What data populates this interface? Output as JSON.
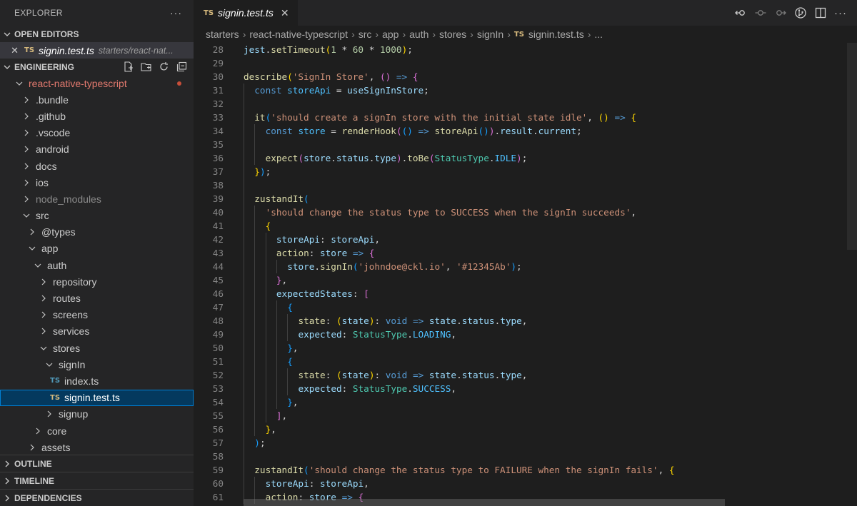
{
  "sidebar": {
    "title": "EXPLORER",
    "more": "···",
    "open_editors": {
      "label": "OPEN EDITORS",
      "items": [
        {
          "close": "✕",
          "badge": "TS",
          "name": "signin.test.ts",
          "path": "starters/react-nat..."
        }
      ]
    },
    "workspace": {
      "label": "ENGINEERING",
      "tree": [
        {
          "label": "react-native-typescript",
          "depth": 1,
          "type": "folder-open",
          "modified": true
        },
        {
          "label": ".bundle",
          "depth": 2,
          "type": "folder"
        },
        {
          "label": ".github",
          "depth": 2,
          "type": "folder"
        },
        {
          "label": ".vscode",
          "depth": 2,
          "type": "folder"
        },
        {
          "label": "android",
          "depth": 2,
          "type": "folder"
        },
        {
          "label": "docs",
          "depth": 2,
          "type": "folder"
        },
        {
          "label": "ios",
          "depth": 2,
          "type": "folder"
        },
        {
          "label": "node_modules",
          "depth": 2,
          "type": "folder",
          "dim": true
        },
        {
          "label": "src",
          "depth": 2,
          "type": "folder-open"
        },
        {
          "label": "@types",
          "depth": 3,
          "type": "folder"
        },
        {
          "label": "app",
          "depth": 3,
          "type": "folder-open"
        },
        {
          "label": "auth",
          "depth": 4,
          "type": "folder-open"
        },
        {
          "label": "repository",
          "depth": 5,
          "type": "folder"
        },
        {
          "label": "routes",
          "depth": 5,
          "type": "folder"
        },
        {
          "label": "screens",
          "depth": 5,
          "type": "folder"
        },
        {
          "label": "services",
          "depth": 5,
          "type": "folder"
        },
        {
          "label": "stores",
          "depth": 5,
          "type": "folder-open"
        },
        {
          "label": "signIn",
          "depth": 6,
          "type": "folder-open"
        },
        {
          "label": "index.ts",
          "depth": 7,
          "type": "file-blue",
          "badge": "TS"
        },
        {
          "label": "signin.test.ts",
          "depth": 7,
          "type": "file-orange",
          "badge": "TS",
          "selected": true
        },
        {
          "label": "signup",
          "depth": 6,
          "type": "folder"
        },
        {
          "label": "core",
          "depth": 4,
          "type": "folder"
        },
        {
          "label": "assets",
          "depth": 3,
          "type": "folder"
        }
      ]
    },
    "bottom_sections": [
      "OUTLINE",
      "TIMELINE",
      "DEPENDENCIES"
    ]
  },
  "editor": {
    "tab": {
      "badge": "TS",
      "label": "signin.test.ts",
      "close": "✕"
    },
    "breadcrumb": [
      "starters",
      "react-native-typescript",
      "src",
      "app",
      "auth",
      "stores",
      "signIn"
    ],
    "breadcrumb_file": {
      "badge": "TS",
      "label": "signin.test.ts"
    },
    "breadcrumb_more": "...",
    "code_lines": [
      {
        "num": "28",
        "indent": 0,
        "tokens": [
          [
            "v",
            "jest"
          ],
          [
            "d",
            "."
          ],
          [
            "f",
            "setTimeout"
          ],
          [
            "p1",
            "("
          ],
          [
            "n",
            "1"
          ],
          [
            "d",
            " * "
          ],
          [
            "n",
            "60"
          ],
          [
            "d",
            " * "
          ],
          [
            "n",
            "1000"
          ],
          [
            "p1",
            ")"
          ],
          [
            "d",
            ";"
          ]
        ]
      },
      {
        "num": "29",
        "indent": 0,
        "tokens": []
      },
      {
        "num": "30",
        "indent": 0,
        "tokens": [
          [
            "f",
            "describe"
          ],
          [
            "p1",
            "("
          ],
          [
            "s",
            "'SignIn Store'"
          ],
          [
            "d",
            ", "
          ],
          [
            "p2",
            "()"
          ],
          [
            "d",
            " "
          ],
          [
            "k",
            "=>"
          ],
          [
            "d",
            " "
          ],
          [
            "p2",
            "{"
          ]
        ]
      },
      {
        "num": "31",
        "indent": 1,
        "tokens": [
          [
            "k",
            "const"
          ],
          [
            "d",
            " "
          ],
          [
            "c",
            "storeApi"
          ],
          [
            "d",
            " = "
          ],
          [
            "v",
            "useSignInStore"
          ],
          [
            "d",
            ";"
          ]
        ]
      },
      {
        "num": "32",
        "indent": 1,
        "tokens": []
      },
      {
        "num": "33",
        "indent": 1,
        "tokens": [
          [
            "f",
            "it"
          ],
          [
            "p3",
            "("
          ],
          [
            "s",
            "'should create a signIn store with the initial state idle'"
          ],
          [
            "d",
            ", "
          ],
          [
            "p1",
            "()"
          ],
          [
            "d",
            " "
          ],
          [
            "k",
            "=>"
          ],
          [
            "d",
            " "
          ],
          [
            "p1",
            "{"
          ]
        ]
      },
      {
        "num": "34",
        "indent": 2,
        "tokens": [
          [
            "k",
            "const"
          ],
          [
            "d",
            " "
          ],
          [
            "c",
            "store"
          ],
          [
            "d",
            " = "
          ],
          [
            "f",
            "renderHook"
          ],
          [
            "p2",
            "("
          ],
          [
            "p3",
            "()"
          ],
          [
            "d",
            " "
          ],
          [
            "k",
            "=>"
          ],
          [
            "d",
            " "
          ],
          [
            "f",
            "storeApi"
          ],
          [
            "p3",
            "()"
          ],
          [
            "p2",
            ")"
          ],
          [
            "d",
            "."
          ],
          [
            "v",
            "result"
          ],
          [
            "d",
            "."
          ],
          [
            "v",
            "current"
          ],
          [
            "d",
            ";"
          ]
        ]
      },
      {
        "num": "35",
        "indent": 2,
        "tokens": []
      },
      {
        "num": "36",
        "indent": 2,
        "tokens": [
          [
            "f",
            "expect"
          ],
          [
            "p2",
            "("
          ],
          [
            "v",
            "store"
          ],
          [
            "d",
            "."
          ],
          [
            "v",
            "status"
          ],
          [
            "d",
            "."
          ],
          [
            "v",
            "type"
          ],
          [
            "p2",
            ")"
          ],
          [
            "d",
            "."
          ],
          [
            "f",
            "toBe"
          ],
          [
            "p2",
            "("
          ],
          [
            "t",
            "StatusType"
          ],
          [
            "d",
            "."
          ],
          [
            "c",
            "IDLE"
          ],
          [
            "p2",
            ")"
          ],
          [
            "d",
            ";"
          ]
        ]
      },
      {
        "num": "37",
        "indent": 1,
        "tokens": [
          [
            "p1",
            "}"
          ],
          [
            "p3",
            ")"
          ],
          [
            "d",
            ";"
          ]
        ]
      },
      {
        "num": "38",
        "indent": 1,
        "tokens": []
      },
      {
        "num": "39",
        "indent": 1,
        "tokens": [
          [
            "f",
            "zustandIt"
          ],
          [
            "p3",
            "("
          ]
        ]
      },
      {
        "num": "40",
        "indent": 2,
        "tokens": [
          [
            "s",
            "'should change the status type to SUCCESS when the signIn succeeds'"
          ],
          [
            "d",
            ","
          ]
        ]
      },
      {
        "num": "41",
        "indent": 2,
        "tokens": [
          [
            "p1",
            "{"
          ]
        ]
      },
      {
        "num": "42",
        "indent": 3,
        "tokens": [
          [
            "v",
            "storeApi"
          ],
          [
            "d",
            ": "
          ],
          [
            "v",
            "storeApi"
          ],
          [
            "d",
            ","
          ]
        ]
      },
      {
        "num": "43",
        "indent": 3,
        "tokens": [
          [
            "f",
            "action"
          ],
          [
            "d",
            ": "
          ],
          [
            "v",
            "store"
          ],
          [
            "d",
            " "
          ],
          [
            "k",
            "=>"
          ],
          [
            "d",
            " "
          ],
          [
            "p2",
            "{"
          ]
        ]
      },
      {
        "num": "44",
        "indent": 4,
        "tokens": [
          [
            "v",
            "store"
          ],
          [
            "d",
            "."
          ],
          [
            "f",
            "signIn"
          ],
          [
            "p3",
            "("
          ],
          [
            "s",
            "'johndoe@ckl.io'"
          ],
          [
            "d",
            ", "
          ],
          [
            "s",
            "'#12345Ab'"
          ],
          [
            "p3",
            ")"
          ],
          [
            "d",
            ";"
          ]
        ]
      },
      {
        "num": "45",
        "indent": 3,
        "tokens": [
          [
            "p2",
            "}"
          ],
          [
            "d",
            ","
          ]
        ]
      },
      {
        "num": "46",
        "indent": 3,
        "tokens": [
          [
            "v",
            "expectedStates"
          ],
          [
            "d",
            ": "
          ],
          [
            "p2",
            "["
          ]
        ]
      },
      {
        "num": "47",
        "indent": 4,
        "tokens": [
          [
            "p3",
            "{"
          ]
        ]
      },
      {
        "num": "48",
        "indent": 5,
        "tokens": [
          [
            "f",
            "state"
          ],
          [
            "d",
            ": "
          ],
          [
            "p1",
            "("
          ],
          [
            "v",
            "state"
          ],
          [
            "p1",
            ")"
          ],
          [
            "d",
            ": "
          ],
          [
            "k",
            "void"
          ],
          [
            "d",
            " "
          ],
          [
            "k",
            "=>"
          ],
          [
            "d",
            " "
          ],
          [
            "v",
            "state"
          ],
          [
            "d",
            "."
          ],
          [
            "v",
            "status"
          ],
          [
            "d",
            "."
          ],
          [
            "v",
            "type"
          ],
          [
            "d",
            ","
          ]
        ]
      },
      {
        "num": "49",
        "indent": 5,
        "tokens": [
          [
            "v",
            "expected"
          ],
          [
            "d",
            ": "
          ],
          [
            "t",
            "StatusType"
          ],
          [
            "d",
            "."
          ],
          [
            "c",
            "LOADING"
          ],
          [
            "d",
            ","
          ]
        ]
      },
      {
        "num": "50",
        "indent": 4,
        "tokens": [
          [
            "p3",
            "}"
          ],
          [
            "d",
            ","
          ]
        ]
      },
      {
        "num": "51",
        "indent": 4,
        "tokens": [
          [
            "p3",
            "{"
          ]
        ]
      },
      {
        "num": "52",
        "indent": 5,
        "tokens": [
          [
            "f",
            "state"
          ],
          [
            "d",
            ": "
          ],
          [
            "p1",
            "("
          ],
          [
            "v",
            "state"
          ],
          [
            "p1",
            ")"
          ],
          [
            "d",
            ": "
          ],
          [
            "k",
            "void"
          ],
          [
            "d",
            " "
          ],
          [
            "k",
            "=>"
          ],
          [
            "d",
            " "
          ],
          [
            "v",
            "state"
          ],
          [
            "d",
            "."
          ],
          [
            "v",
            "status"
          ],
          [
            "d",
            "."
          ],
          [
            "v",
            "type"
          ],
          [
            "d",
            ","
          ]
        ]
      },
      {
        "num": "53",
        "indent": 5,
        "tokens": [
          [
            "v",
            "expected"
          ],
          [
            "d",
            ": "
          ],
          [
            "t",
            "StatusType"
          ],
          [
            "d",
            "."
          ],
          [
            "c",
            "SUCCESS"
          ],
          [
            "d",
            ","
          ]
        ]
      },
      {
        "num": "54",
        "indent": 4,
        "tokens": [
          [
            "p3",
            "}"
          ],
          [
            "d",
            ","
          ]
        ]
      },
      {
        "num": "55",
        "indent": 3,
        "tokens": [
          [
            "p2",
            "]"
          ],
          [
            "d",
            ","
          ]
        ]
      },
      {
        "num": "56",
        "indent": 2,
        "tokens": [
          [
            "p1",
            "}"
          ],
          [
            "d",
            ","
          ]
        ]
      },
      {
        "num": "57",
        "indent": 1,
        "tokens": [
          [
            "p3",
            ")"
          ],
          [
            "d",
            ";"
          ]
        ]
      },
      {
        "num": "58",
        "indent": 1,
        "tokens": []
      },
      {
        "num": "59",
        "indent": 1,
        "tokens": [
          [
            "f",
            "zustandIt"
          ],
          [
            "p3",
            "("
          ],
          [
            "s",
            "'should change the status type to FAILURE when the signIn fails'"
          ],
          [
            "d",
            ", "
          ],
          [
            "p1",
            "{"
          ]
        ]
      },
      {
        "num": "60",
        "indent": 2,
        "tokens": [
          [
            "v",
            "storeApi"
          ],
          [
            "d",
            ": "
          ],
          [
            "v",
            "storeApi"
          ],
          [
            "d",
            ","
          ]
        ]
      },
      {
        "num": "61",
        "indent": 2,
        "tokens": [
          [
            "f",
            "action"
          ],
          [
            "d",
            ": "
          ],
          [
            "v",
            "store"
          ],
          [
            "d",
            " "
          ],
          [
            "k",
            "=>"
          ],
          [
            "d",
            " "
          ],
          [
            "p2",
            "{"
          ]
        ]
      }
    ]
  }
}
